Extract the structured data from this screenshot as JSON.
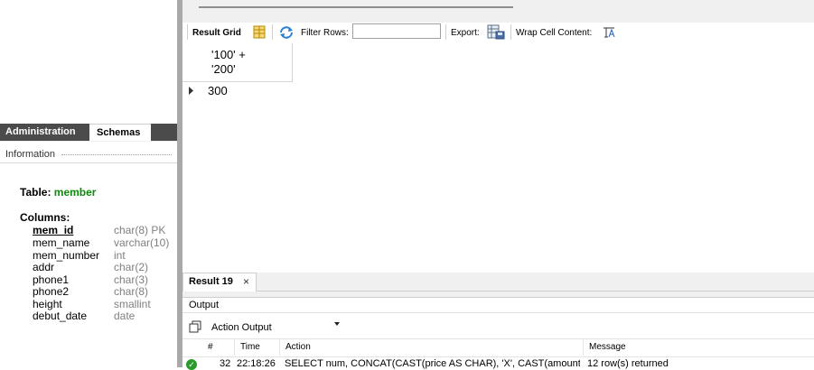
{
  "sidebar": {
    "tabs": {
      "administration": "Administration",
      "schemas": "Schemas"
    },
    "info_label": "Information",
    "table_prefix": "Table: ",
    "table_name": "member",
    "columns_label": "Columns:",
    "columns": [
      {
        "name": "mem_id",
        "type": "char(8) PK"
      },
      {
        "name": "mem_name",
        "type": "varchar(10)"
      },
      {
        "name": "mem_number",
        "type": "int"
      },
      {
        "name": "addr",
        "type": "char(2)"
      },
      {
        "name": "phone1",
        "type": "char(3)"
      },
      {
        "name": "phone2",
        "type": "char(8)"
      },
      {
        "name": "height",
        "type": "smallint"
      },
      {
        "name": "debut_date",
        "type": "date"
      }
    ]
  },
  "toolbar": {
    "result_grid": "Result Grid",
    "filter_rows": "Filter Rows:",
    "filter_value": "",
    "export": "Export:",
    "wrap_cell": "Wrap Cell Content:"
  },
  "grid": {
    "column_header": "'100' +\n'200'",
    "rows": [
      "300"
    ]
  },
  "result_tab": {
    "label": "Result 19",
    "close": "×"
  },
  "output": {
    "title": "Output",
    "selector": "Action Output",
    "headers": {
      "num": "#",
      "time": "Time",
      "action": "Action",
      "message": "Message"
    },
    "rows": [
      {
        "num": "32",
        "time": "22:18:26",
        "action": "SELECT num, CONCAT(CAST(price AS CHAR), 'X', CAST(amount ...",
        "message": "12 row(s) returned",
        "status": "ok"
      }
    ]
  },
  "colors": {
    "accent_green": "#0c8a0c",
    "tab_dark": "#4b4b4b",
    "splitter": "#a9a9a9"
  }
}
